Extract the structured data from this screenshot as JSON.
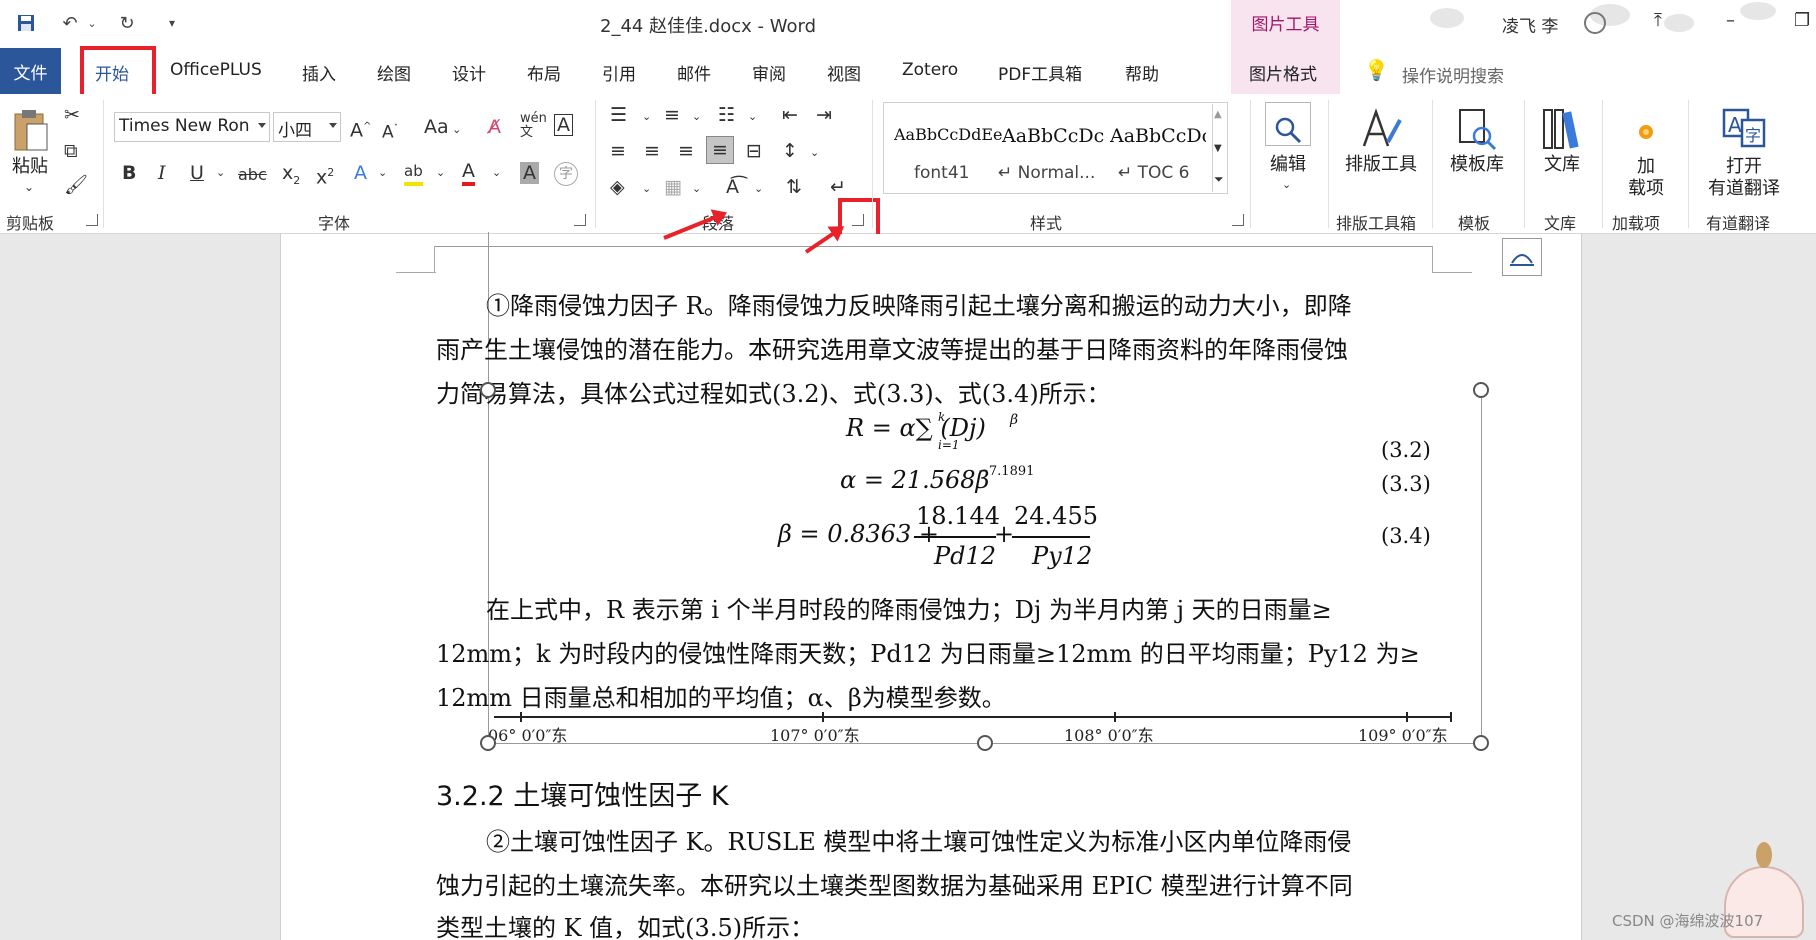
{
  "title_bar": {
    "document_title": "2_44 赵佳佳.docx  -  Word",
    "picture_tools": "图片工具",
    "user_name": "凌飞 李",
    "quick_access_icons": [
      "save-icon",
      "undo-icon",
      "redo-icon",
      "customize-icon"
    ]
  },
  "tabs": {
    "file": "文件",
    "items": [
      "开始",
      "OfficePLUS",
      "插入",
      "绘图",
      "设计",
      "布局",
      "引用",
      "邮件",
      "审阅",
      "视图",
      "Zotero",
      "PDF工具箱",
      "帮助"
    ],
    "picture_format": "图片格式",
    "tell_me": "操作说明搜索"
  },
  "ribbon": {
    "clipboard": {
      "paste": "粘贴",
      "label": "剪贴板"
    },
    "font": {
      "font_name": "Times New Ron",
      "font_size": "小四",
      "label": "字体",
      "change_case": "Aa"
    },
    "paragraph": {
      "label": "段落"
    },
    "styles": {
      "label": "样式",
      "items": [
        {
          "sample": "AaBbCcDdEe",
          "name": "font41"
        },
        {
          "sample": "AaBbCcDc",
          "name": "↵ Normal..."
        },
        {
          "sample": "AaBbCcDc",
          "name": "↵ TOC 6"
        }
      ]
    },
    "editing": {
      "label": "编辑"
    },
    "layout_tools": {
      "button": "排版工具",
      "group": "排版工具箱"
    },
    "templates": {
      "button": "模板库",
      "group": "模板"
    },
    "library": {
      "button": "文库",
      "group": "文库"
    },
    "addins": {
      "button_line1": "加",
      "button_line2": "载项",
      "group": "加载项"
    },
    "youdao": {
      "button_line1": "打开",
      "button_line2": "有道翻译",
      "group": "有道翻译"
    }
  },
  "document": {
    "para1_line1": "①降雨侵蚀力因子 R。降雨侵蚀力反映降雨引起土壤分离和搬运的动力大小，即降",
    "para1_line2": "雨产生土壤侵蚀的潜在能力。本研究选用章文波等提出的基于日降雨资料的年降雨侵蚀",
    "para1_line3": "力简易算法，具体公式过程如式(3.2)、式(3.3)、式(3.4)所示：",
    "eq1": "R = α∑ (Dj)",
    "eq1_sup_k": "k",
    "eq1_sub_i": "i=1",
    "eq1_sup_beta": "β",
    "eq2": "α = 21.568β",
    "eq2_sup": "−7.1891",
    "eq3_lhs": "β = 0.8363 +",
    "eq3_num1": "18.144",
    "eq3_den1": "Pd12",
    "eq3_plus": "+",
    "eq3_num2": "24.455",
    "eq3_den2": "Py12",
    "eq_numbers": [
      "(3.2)",
      "(3.3)",
      "(3.4)"
    ],
    "para2_line1": "在上式中，R 表示第 i 个半月时段的降雨侵蚀力；Dj 为半月内第 j 天的日雨量≥",
    "para2_line2": "12mm；k 为时段内的侵蚀性降雨天数；Pd12 为日雨量≥12mm 的日平均雨量；Py12 为≥",
    "para2_line3": "12mm 日雨量总和相加的平均值；α、β为模型参数。",
    "map_coords": [
      "06°  0′0″东",
      "107°  0′0″东",
      "108°  0′0″东",
      "109°  0′0″东"
    ],
    "heading": "3.2.2 土壤可蚀性因子 K",
    "para3_line1": "②土壤可蚀性因子 K。RUSLE 模型中将土壤可蚀性定义为标准小区内单位降雨侵",
    "para3_line2": "蚀力引起的土壤流失率。本研究以土壤类型图数据为基础采用 EPIC 模型进行计算不同",
    "para3_line3": "类型土壤的 K 值，如式(3.5)所示："
  },
  "watermark": "CSDN @海绵波波107"
}
